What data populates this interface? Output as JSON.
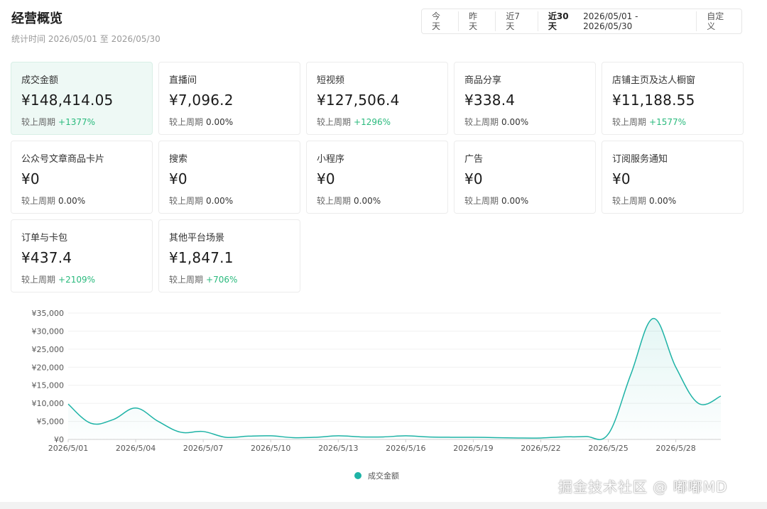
{
  "header": {
    "title": "经营概览",
    "subtitle": "统计时间 2026/05/01 至 2026/05/30"
  },
  "range": {
    "today": "今天",
    "yesterday": "昨天",
    "last7": "近7天",
    "last30": "近30天",
    "dates": "2026/05/01 - 2026/05/30",
    "custom": "自定义"
  },
  "cards": [
    {
      "label": "成交金额",
      "value": "¥148,414.05",
      "cmp_label": "较上周期",
      "pct": "+1377%",
      "up": true,
      "active": true
    },
    {
      "label": "直播间",
      "value": "¥7,096.2",
      "cmp_label": "较上周期",
      "pct": "0.00%",
      "up": false
    },
    {
      "label": "短视频",
      "value": "¥127,506.4",
      "cmp_label": "较上周期",
      "pct": "+1296%",
      "up": true
    },
    {
      "label": "商品分享",
      "value": "¥338.4",
      "cmp_label": "较上周期",
      "pct": "0.00%",
      "up": false
    },
    {
      "label": "店铺主页及达人橱窗",
      "value": "¥11,188.55",
      "cmp_label": "较上周期",
      "pct": "+1577%",
      "up": true
    },
    {
      "label": "公众号文章商品卡片",
      "value": "¥0",
      "cmp_label": "较上周期",
      "pct": "0.00%",
      "up": false
    },
    {
      "label": "搜索",
      "value": "¥0",
      "cmp_label": "较上周期",
      "pct": "0.00%",
      "up": false
    },
    {
      "label": "小程序",
      "value": "¥0",
      "cmp_label": "较上周期",
      "pct": "0.00%",
      "up": false
    },
    {
      "label": "广告",
      "value": "¥0",
      "cmp_label": "较上周期",
      "pct": "0.00%",
      "up": false
    },
    {
      "label": "订阅服务通知",
      "value": "¥0",
      "cmp_label": "较上周期",
      "pct": "0.00%",
      "up": false
    },
    {
      "label": "订单与卡包",
      "value": "¥437.4",
      "cmp_label": "较上周期",
      "pct": "+2109%",
      "up": true
    },
    {
      "label": "其他平台场景",
      "value": "¥1,847.1",
      "cmp_label": "较上周期",
      "pct": "+706%",
      "up": true
    }
  ],
  "colors": {
    "accent": "#1eb3a6",
    "up": "#2aba7d",
    "active_card_bg": "#eef9f5"
  },
  "chart_data": {
    "type": "area",
    "x": [
      "2026/5/01",
      "2026/5/02",
      "2026/5/03",
      "2026/5/04",
      "2026/5/05",
      "2026/5/06",
      "2026/5/07",
      "2026/5/08",
      "2026/5/09",
      "2026/5/10",
      "2026/5/11",
      "2026/5/12",
      "2026/5/13",
      "2026/5/14",
      "2026/5/15",
      "2026/5/16",
      "2026/5/17",
      "2026/5/18",
      "2026/5/19",
      "2026/5/20",
      "2026/5/21",
      "2026/5/22",
      "2026/5/23",
      "2026/5/24",
      "2026/5/25",
      "2026/5/26",
      "2026/5/27",
      "2026/5/28",
      "2026/5/29",
      "2026/5/30"
    ],
    "x_tick_labels": [
      "2026/5/01",
      "2026/5/04",
      "2026/5/07",
      "2026/5/10",
      "2026/5/13",
      "2026/5/16",
      "2026/5/19",
      "2026/5/22",
      "2026/5/25",
      "2026/5/28"
    ],
    "y_tick_labels": [
      "¥0",
      "¥5,000",
      "¥10,000",
      "¥15,000",
      "¥20,000",
      "¥25,000",
      "¥30,000",
      "¥35,000"
    ],
    "ylim": [
      0,
      35000
    ],
    "grid": true,
    "legend_position": "bottom-center",
    "series": [
      {
        "name": "成交金额",
        "color": "#1eb3a6",
        "values": [
          9800,
          4500,
          5500,
          8700,
          5000,
          2000,
          2200,
          600,
          900,
          1000,
          500,
          600,
          1000,
          700,
          700,
          1000,
          700,
          600,
          600,
          500,
          400,
          400,
          700,
          800,
          1500,
          18000,
          33500,
          20000,
          10000,
          12000
        ]
      }
    ]
  },
  "watermark": "掘金技术社区 @ 嘟嘟MD"
}
